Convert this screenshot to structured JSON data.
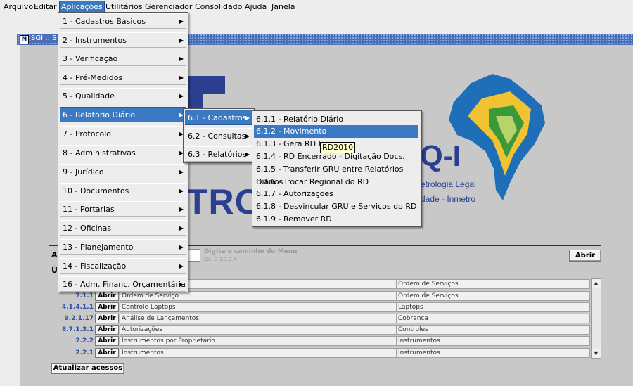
{
  "menubar": [
    "Arquivo",
    "Editar",
    "Aplicações",
    "Utilitários",
    "Gerenciador",
    "Consolidado",
    "Ajuda",
    "Janela"
  ],
  "window_title": "SGI :: S",
  "window_icon": "N",
  "menu_aplicacoes": [
    "1 - Cadastros Básicos",
    "2 - Instrumentos",
    "3 - Verificação",
    "4 - Pré-Medidos",
    "5 - Qualidade",
    "6 - Relatório Diário",
    "7 - Protocolo",
    "8 - Administrativas",
    "9 - Jurídico",
    "10 - Documentos",
    "11 - Portarias",
    "12 - Oficinas",
    "13 - Planejamento",
    "14 - Fiscalização",
    "16 - Adm. Financ. Orçamentária"
  ],
  "menu_relatorio": [
    "6.1 - Cadastros",
    "6.2 - Consultas",
    "6.3 - Relatórios"
  ],
  "menu_cadastros": [
    "6.1.1 - Relatório Diário",
    "6.1.2 - Movimento",
    "6.1.3 - Gera RD Le",
    "6.1.4 - RD Encerrado - Digitação Docs.",
    "6.1.5 - Transferir GRU entre Relatórios Diários",
    "6.1.6 - Trocar Regional do RD",
    "6.1.7 - Autorizações",
    "6.1.8 - Desvincular GRU e Serviços do RD",
    "6.1.9 - Remover RD"
  ],
  "tooltip": "RD2010",
  "logo": {
    "tro": "TRO",
    "qi": "Q-I",
    "line1": "etrologia Legal",
    "line2": "dade - Inmetro"
  },
  "path": {
    "label": "Ac",
    "hint": "Digite o caminho do Menu",
    "example": "Ex.: 3.1.1.3.4",
    "button": "Abrir"
  },
  "recent_label": "Ú",
  "rows": [
    {
      "code": "",
      "open": "",
      "name": "de Serviço / CSS",
      "group": "Ordem de Serviços"
    },
    {
      "code": "7.1.1",
      "open": "Abrir",
      "name": "Ordem de Serviço",
      "group": "Ordem de Serviços"
    },
    {
      "code": "4.1.4.1.1",
      "open": "Abrir",
      "name": "Controle Laptops",
      "group": "Laptops"
    },
    {
      "code": "9.2.1.17",
      "open": "Abrir",
      "name": "Análise de Lançamentos",
      "group": "Cobrança"
    },
    {
      "code": "8.7.1.3.1",
      "open": "Abrir",
      "name": "Autorizações",
      "group": "Controles"
    },
    {
      "code": "2.2.2",
      "open": "Abrir",
      "name": "Instrumentos por Proprietário",
      "group": "Instrumentos"
    },
    {
      "code": "2.2.1",
      "open": "Abrir",
      "name": "Instrumentos",
      "group": "Instrumentos"
    }
  ],
  "update_button": "Atualizar acessos",
  "colors": {
    "highlight": "#3b79c2",
    "logo_blue": "#2a3f8f",
    "code_blue": "#2b4fa8"
  }
}
